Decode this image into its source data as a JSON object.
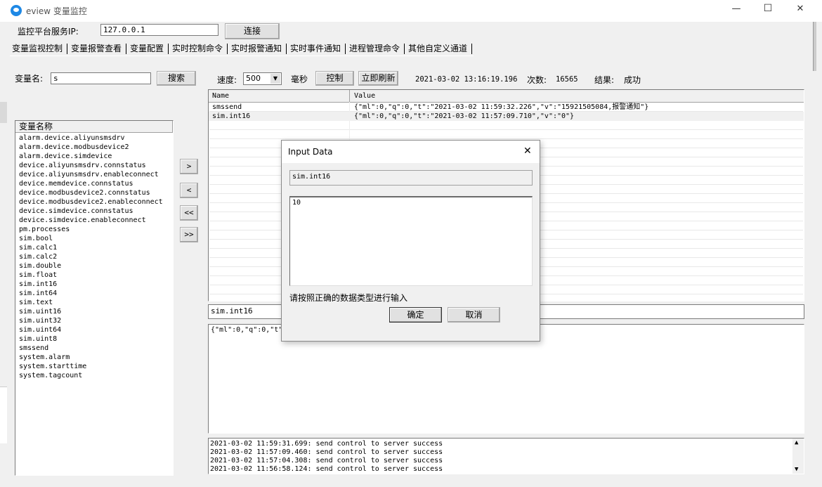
{
  "window": {
    "title": "eview 变量监控",
    "minimize": "—",
    "maximize": "☐",
    "close": "✕"
  },
  "server": {
    "label": "监控平台服务IP:",
    "ip": "127.0.0.1",
    "connect": "连接"
  },
  "tabs": [
    "变量监视控制",
    "变量报警查看",
    "变量配置",
    "实时控制命令",
    "实时报警通知",
    "实时事件通知",
    "进程管理命令",
    "其他自定义通道"
  ],
  "search": {
    "label": "变量名:",
    "value": "s",
    "button": "搜索"
  },
  "toolbar": {
    "speed_label": "速度:",
    "speed_value": "500",
    "unit": "毫秒",
    "control": "控制",
    "refresh": "立即刷新",
    "timestamp": "2021-03-02 13:16:19.196",
    "count_label": "次数:",
    "count_value": "16565",
    "result_label": "结果:",
    "result_value": "成功"
  },
  "var_list": {
    "header": "变量名称",
    "items": [
      "alarm.device.aliyunsmsdrv",
      "alarm.device.modbusdevice2",
      "alarm.device.simdevice",
      "device.aliyunsmsdrv.connstatus",
      "device.aliyunsmsdrv.enableconnect",
      "device.memdevice.connstatus",
      "device.modbusdevice2.connstatus",
      "device.modbusdevice2.enableconnect",
      "device.simdevice.connstatus",
      "device.simdevice.enableconnect",
      "pm.processes",
      "sim.bool",
      "sim.calc1",
      "sim.calc2",
      "sim.double",
      "sim.float",
      "sim.int16",
      "sim.int64",
      "sim.text",
      "sim.uint16",
      "sim.uint32",
      "sim.uint64",
      "sim.uint8",
      "smssend",
      "system.alarm",
      "system.starttime",
      "system.tagcount"
    ]
  },
  "move_buttons": [
    ">",
    "<",
    "<<",
    ">>"
  ],
  "watch_table": {
    "columns": [
      "Name",
      "Value"
    ],
    "rows": [
      {
        "name": "smssend",
        "value": "{\"ml\":0,\"q\":0,\"t\":\"2021-03-02 11:59:32.226\",\"v\":\"15921505084,报警通知\"}"
      },
      {
        "name": "sim.int16",
        "value": "{\"ml\":0,\"q\":0,\"t\":\"2021-03-02 11:57:09.710\",\"v\":\"0\"}"
      }
    ]
  },
  "selected_name": "sim.int16",
  "detail_text": "{\"ml\":0,\"q\":0,\"t\"",
  "log": [
    "2021-03-02 11:59:31.699: send control to server success",
    "2021-03-02 11:57:09.460: send control to server success",
    "2021-03-02 11:57:04.308: send control to server success",
    "2021-03-02 11:56:58.124: send control to server success"
  ],
  "dialog": {
    "title": "Input Data",
    "close": "✕",
    "var_name": "sim.int16",
    "value": "10",
    "hint": "请按照正确的数据类型进行输入",
    "ok": "确定",
    "cancel": "取消"
  },
  "colors": {
    "accent": "#1e88e5",
    "highlight_row": "#f0f0f0"
  }
}
